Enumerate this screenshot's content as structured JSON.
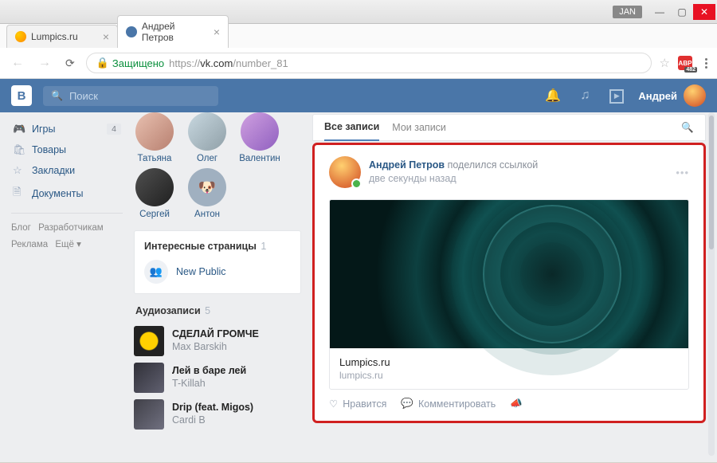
{
  "window": {
    "user": "JAN"
  },
  "browser": {
    "tabs": [
      {
        "title": "Lumpics.ru"
      },
      {
        "title": "Андрей Петров"
      }
    ],
    "secure_label": "Защищено",
    "url_prefix": "https://",
    "url_host": "vk.com",
    "url_path": "/number_81",
    "abp_count": "482"
  },
  "vk_header": {
    "search_placeholder": "Поиск",
    "username": "Андрей"
  },
  "left_nav": {
    "items": [
      {
        "icon": "🎮",
        "label": "Игры",
        "badge": "4"
      },
      {
        "icon": "🛍",
        "label": "Товары"
      },
      {
        "icon": "☆",
        "label": "Закладки"
      },
      {
        "icon": "🗎",
        "label": "Документы"
      }
    ],
    "footer": [
      "Блог",
      "Разработчикам",
      "Реклама",
      "Ещё ▾"
    ]
  },
  "friends": [
    {
      "name": "Татьяна"
    },
    {
      "name": "Олег"
    },
    {
      "name": "Валентин"
    },
    {
      "name": "Сергей"
    },
    {
      "name": "Антон"
    }
  ],
  "pages_block": {
    "title": "Интересные страницы",
    "count": "1",
    "items": [
      {
        "name": "New Public"
      }
    ]
  },
  "audio_block": {
    "title": "Аудиозаписи",
    "count": "5",
    "tracks": [
      {
        "title": "СДЕЛАЙ ГРОМЧЕ",
        "artist": "Max Barskih"
      },
      {
        "title": "Лей в баре лей",
        "artist": "T-Killah"
      },
      {
        "title": "Drip (feat. Migos)",
        "artist": "Cardi B"
      }
    ]
  },
  "wall": {
    "tab_all": "Все записи",
    "tab_mine": "Мои записи"
  },
  "post": {
    "author": "Андрей Петров",
    "verb": "поделился ссылкой",
    "time": "две секунды назад",
    "snippet_title": "Lumpics.ru",
    "snippet_domain": "lumpics.ru",
    "like": "Нравится",
    "comment": "Комментировать"
  }
}
